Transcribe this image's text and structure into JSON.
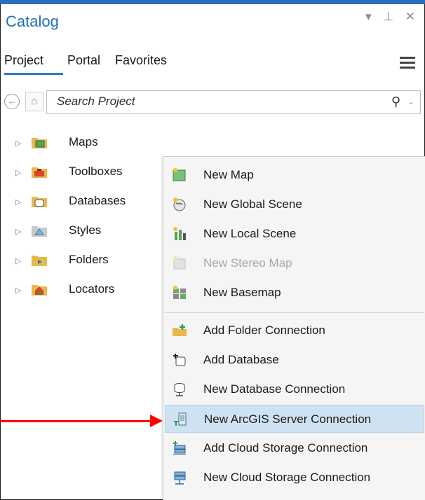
{
  "pane": {
    "title": "Catalog",
    "controls": "▾ ⊥ ✕"
  },
  "tabs": [
    {
      "label": "Project",
      "active": true
    },
    {
      "label": "Portal",
      "active": false
    },
    {
      "label": "Favorites",
      "active": false
    }
  ],
  "search": {
    "placeholder": "Search Project"
  },
  "tree": [
    {
      "label": "Maps",
      "icon": "map-folder-icon"
    },
    {
      "label": "Toolboxes",
      "icon": "toolbox-icon"
    },
    {
      "label": "Databases",
      "icon": "database-folder-icon"
    },
    {
      "label": "Styles",
      "icon": "styles-icon"
    },
    {
      "label": "Folders",
      "icon": "folder-icon"
    },
    {
      "label": "Locators",
      "icon": "locator-icon"
    }
  ],
  "menu": [
    {
      "label": "New Map",
      "icon": "new-map-icon",
      "enabled": true
    },
    {
      "label": "New Global Scene",
      "icon": "global-scene-icon",
      "enabled": true
    },
    {
      "label": "New Local Scene",
      "icon": "local-scene-icon",
      "enabled": true
    },
    {
      "label": "New Stereo Map",
      "icon": "stereo-map-icon",
      "enabled": false
    },
    {
      "label": "New Basemap",
      "icon": "basemap-icon",
      "enabled": true
    },
    {
      "label": "Add Folder Connection",
      "icon": "folder-connection-icon",
      "enabled": true
    },
    {
      "label": "Add Database",
      "icon": "add-database-icon",
      "enabled": true
    },
    {
      "label": "New Database Connection",
      "icon": "database-connection-icon",
      "enabled": true
    },
    {
      "label": "New ArcGIS Server Connection",
      "icon": "server-connection-icon",
      "enabled": true,
      "highlighted": true
    },
    {
      "label": "Add Cloud Storage Connection",
      "icon": "add-cloud-storage-icon",
      "enabled": true
    },
    {
      "label": "New Cloud Storage Connection",
      "icon": "new-cloud-storage-icon",
      "enabled": true
    }
  ],
  "colors": {
    "accent": "#1c6fb8",
    "highlight": "#cfe2f2",
    "annotation": "#ff0000"
  }
}
